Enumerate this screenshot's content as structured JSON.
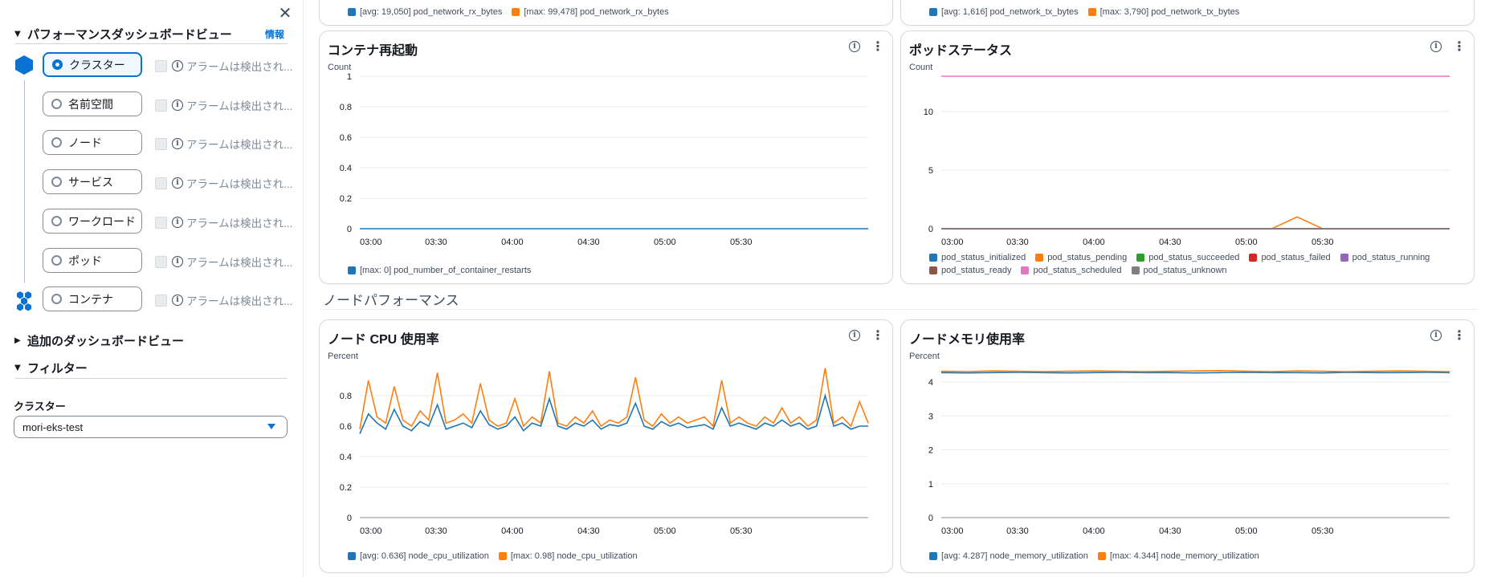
{
  "sidebar": {
    "perf_section_title": "パフォーマンスダッシュボードビュー",
    "info_label": "情報",
    "views": [
      {
        "label": "クラスター",
        "selected": true,
        "alarm": "アラームは検出され..."
      },
      {
        "label": "名前空間",
        "selected": false,
        "alarm": "アラームは検出され..."
      },
      {
        "label": "ノード",
        "selected": false,
        "alarm": "アラームは検出され..."
      },
      {
        "label": "サービス",
        "selected": false,
        "alarm": "アラームは検出され..."
      },
      {
        "label": "ワークロード",
        "selected": false,
        "alarm": "アラームは検出され..."
      },
      {
        "label": "ポッド",
        "selected": false,
        "alarm": "アラームは検出され..."
      },
      {
        "label": "コンテナ",
        "selected": false,
        "alarm": "アラームは検出され..."
      }
    ],
    "additional_views_title": "追加のダッシュボードビュー",
    "filter_title": "フィルター",
    "cluster_label": "クラスター",
    "cluster_value": "mori-eks-test"
  },
  "top_legends": {
    "left": [
      {
        "text": "[avg: 19,050] pod_network_rx_bytes",
        "color": "#1f77b4"
      },
      {
        "text": "[max: 99,478] pod_network_rx_bytes",
        "color": "#ff7f0e"
      }
    ],
    "right": [
      {
        "text": "[avg: 1,616] pod_network_tx_bytes",
        "color": "#1f77b4"
      },
      {
        "text": "[max: 3,790] pod_network_tx_bytes",
        "color": "#ff7f0e"
      }
    ]
  },
  "node_section_label": "ノードパフォーマンス",
  "panels": {
    "restarts": {
      "title": "コンテナ再起動"
    },
    "pod_status": {
      "title": "ポッドステータス"
    },
    "node_cpu": {
      "title": "ノード CPU 使用率"
    },
    "node_mem": {
      "title": "ノードメモリ使用率"
    }
  },
  "chart_data": [
    {
      "id": "restarts",
      "type": "line",
      "ylabel": "Count",
      "ylim": [
        0,
        1
      ],
      "yticks": [
        "0",
        "0.2",
        "0.4",
        "0.6",
        "0.8",
        "1"
      ],
      "yticks_values": [
        0,
        0.2,
        0.4,
        0.6,
        0.8,
        1
      ],
      "xticks": [
        "03:00",
        "03:30",
        "04:00",
        "04:30",
        "05:00",
        "05:30"
      ],
      "xmax_minutes": 200,
      "series": [
        {
          "name": "[max: 0] pod_number_of_container_restarts",
          "color": "#1f77b4",
          "values": [
            0,
            0,
            0,
            0,
            0,
            0,
            0,
            0,
            0,
            0,
            0,
            0,
            0,
            0,
            0,
            0,
            0,
            0,
            0,
            0,
            0
          ]
        }
      ]
    },
    {
      "id": "pod_status",
      "type": "line",
      "ylabel": "Count",
      "ylim": [
        0,
        13
      ],
      "yticks": [
        "0",
        "5",
        "10"
      ],
      "yticks_values": [
        0,
        5,
        10
      ],
      "xticks": [
        "03:00",
        "03:30",
        "04:00",
        "04:30",
        "05:00",
        "05:30"
      ],
      "xmax_minutes": 200,
      "series": [
        {
          "name": "pod_status_initialized",
          "color": "#1f77b4",
          "values": [
            0,
            0,
            0,
            0,
            0,
            0,
            0,
            0,
            0,
            0,
            0,
            0,
            0,
            0,
            0,
            0,
            0,
            0,
            0,
            0,
            0
          ]
        },
        {
          "name": "pod_status_pending",
          "color": "#ff7f0e",
          "values": [
            0,
            0,
            0,
            0,
            0,
            0,
            0,
            0,
            0,
            0,
            0,
            0,
            0,
            0,
            1,
            0,
            0,
            0,
            0,
            0,
            0
          ]
        },
        {
          "name": "pod_status_succeeded",
          "color": "#2ca02c",
          "values": [
            0,
            0,
            0,
            0,
            0,
            0,
            0,
            0,
            0,
            0,
            0,
            0,
            0,
            0,
            0,
            0,
            0,
            0,
            0,
            0,
            0
          ]
        },
        {
          "name": "pod_status_failed",
          "color": "#d62728",
          "values": [
            0,
            0,
            0,
            0,
            0,
            0,
            0,
            0,
            0,
            0,
            0,
            0,
            0,
            0,
            0,
            0,
            0,
            0,
            0,
            0,
            0
          ]
        },
        {
          "name": "pod_status_running",
          "color": "#9467bd",
          "values": [
            0,
            0,
            0,
            0,
            0,
            0,
            0,
            0,
            0,
            0,
            0,
            0,
            0,
            0,
            0,
            0,
            0,
            0,
            0,
            0,
            0
          ]
        },
        {
          "name": "pod_status_ready",
          "color": "#8c564b",
          "values": [
            0,
            0,
            0,
            0,
            0,
            0,
            0,
            0,
            0,
            0,
            0,
            0,
            0,
            0,
            0,
            0,
            0,
            0,
            0,
            0,
            0
          ]
        },
        {
          "name": "pod_status_scheduled",
          "color": "#e377c2",
          "values": [
            13,
            13,
            13,
            13,
            13,
            13,
            13,
            13,
            13,
            13,
            13,
            13,
            13,
            13,
            13,
            13,
            13,
            13,
            13,
            13,
            13
          ]
        },
        {
          "name": "pod_status_unknown",
          "color": "#7f7f7f",
          "values": [
            0,
            0,
            0,
            0,
            0,
            0,
            0,
            0,
            0,
            0,
            0,
            0,
            0,
            0,
            0,
            0,
            0,
            0,
            0,
            0,
            0
          ]
        }
      ]
    },
    {
      "id": "node_cpu",
      "type": "line",
      "ylabel": "Percent",
      "ylim": [
        0,
        1
      ],
      "yticks": [
        "0",
        "0.2",
        "0.4",
        "0.6",
        "0.8"
      ],
      "yticks_values": [
        0,
        0.2,
        0.4,
        0.6,
        0.8
      ],
      "xticks": [
        "03:00",
        "03:30",
        "04:00",
        "04:30",
        "05:00",
        "05:30"
      ],
      "xmax_minutes": 200,
      "series": [
        {
          "name": "[avg: 0.636] node_cpu_utilization",
          "color": "#1f77b4",
          "values": [
            0.55,
            0.68,
            0.62,
            0.58,
            0.71,
            0.6,
            0.57,
            0.63,
            0.6,
            0.74,
            0.58,
            0.6,
            0.62,
            0.59,
            0.7,
            0.61,
            0.58,
            0.6,
            0.66,
            0.57,
            0.62,
            0.6,
            0.78,
            0.6,
            0.58,
            0.62,
            0.6,
            0.64,
            0.58,
            0.61,
            0.6,
            0.62,
            0.75,
            0.6,
            0.58,
            0.63,
            0.6,
            0.62,
            0.59,
            0.6,
            0.61,
            0.58,
            0.72,
            0.6,
            0.62,
            0.6,
            0.58,
            0.62,
            0.6,
            0.64,
            0.6,
            0.62,
            0.58,
            0.6,
            0.8,
            0.6,
            0.62,
            0.58,
            0.6,
            0.6
          ]
        },
        {
          "name": "[max: 0.98] node_cpu_utilization",
          "color": "#ff7f0e",
          "values": [
            0.58,
            0.9,
            0.66,
            0.62,
            0.86,
            0.64,
            0.6,
            0.7,
            0.64,
            0.95,
            0.62,
            0.64,
            0.68,
            0.62,
            0.88,
            0.64,
            0.6,
            0.62,
            0.78,
            0.6,
            0.66,
            0.62,
            0.96,
            0.62,
            0.6,
            0.66,
            0.62,
            0.7,
            0.6,
            0.64,
            0.62,
            0.66,
            0.92,
            0.64,
            0.6,
            0.68,
            0.62,
            0.66,
            0.62,
            0.64,
            0.66,
            0.6,
            0.9,
            0.62,
            0.66,
            0.62,
            0.6,
            0.66,
            0.62,
            0.72,
            0.62,
            0.66,
            0.6,
            0.64,
            0.98,
            0.62,
            0.66,
            0.6,
            0.76,
            0.62
          ]
        }
      ]
    },
    {
      "id": "node_mem",
      "type": "line",
      "ylabel": "Percent",
      "ylim": [
        0,
        4.5
      ],
      "yticks": [
        "0",
        "1",
        "2",
        "3",
        "4"
      ],
      "yticks_values": [
        0,
        1,
        2,
        3,
        4
      ],
      "xticks": [
        "03:00",
        "03:30",
        "04:00",
        "04:30",
        "05:00",
        "05:30"
      ],
      "xmax_minutes": 200,
      "series": [
        {
          "name": "[avg: 4.287] node_memory_utilization",
          "color": "#1f77b4",
          "values": [
            4.28,
            4.27,
            4.28,
            4.29,
            4.28,
            4.27,
            4.28,
            4.29,
            4.28,
            4.28,
            4.27,
            4.28,
            4.29,
            4.28,
            4.28,
            4.27,
            4.29,
            4.28,
            4.28,
            4.29,
            4.28
          ]
        },
        {
          "name": "[max: 4.344] node_memory_utilization",
          "color": "#ff7f0e",
          "values": [
            4.32,
            4.31,
            4.33,
            4.32,
            4.31,
            4.32,
            4.33,
            4.32,
            4.31,
            4.32,
            4.33,
            4.34,
            4.32,
            4.31,
            4.33,
            4.32,
            4.31,
            4.32,
            4.33,
            4.32,
            4.31
          ]
        }
      ]
    }
  ],
  "colors": {
    "accent": "#0972d3",
    "hex_icon": "#0972d3"
  }
}
